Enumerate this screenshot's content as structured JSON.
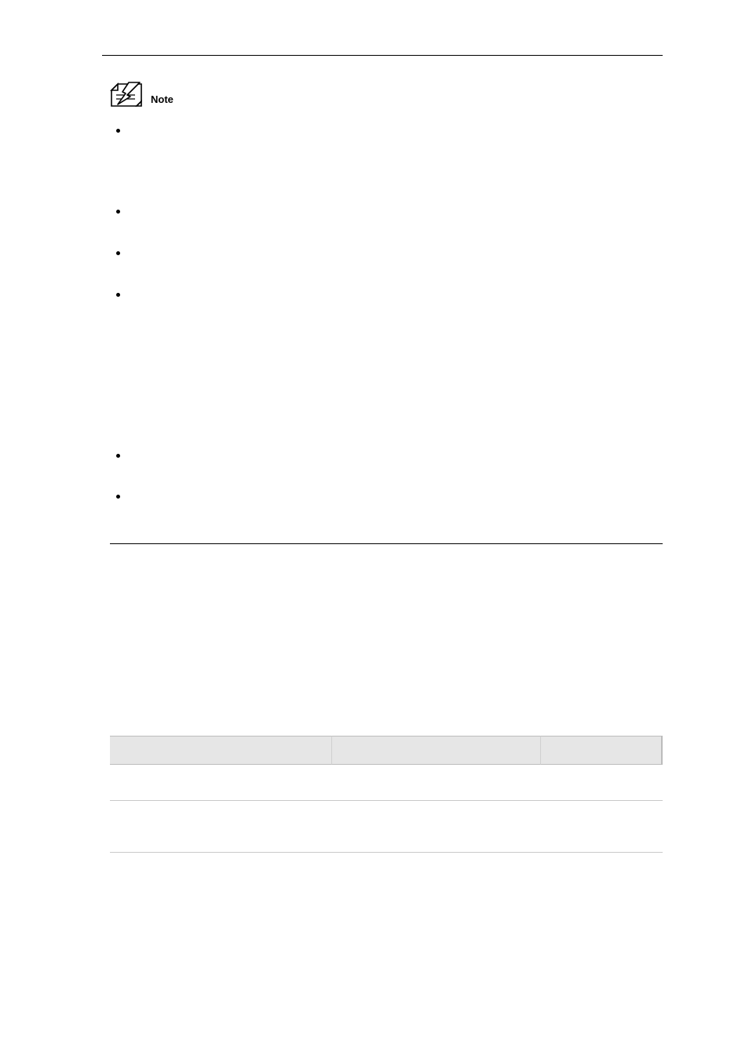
{
  "note": {
    "label": "Note",
    "items": [
      {
        "lines": [
          "",
          "",
          "",
          ""
        ]
      },
      {
        "lines": [
          "",
          ""
        ]
      },
      {
        "lines": [
          "",
          ""
        ]
      },
      {
        "lines": [
          "",
          "",
          "",
          "",
          "",
          "",
          "",
          ""
        ]
      },
      {
        "lines": [
          "",
          ""
        ]
      },
      {
        "lines": [
          "",
          ""
        ]
      }
    ]
  },
  "table": {
    "headers": [
      "",
      "",
      ""
    ],
    "rows": [
      [
        "",
        "",
        ""
      ],
      [
        "",
        "",
        ""
      ]
    ]
  }
}
